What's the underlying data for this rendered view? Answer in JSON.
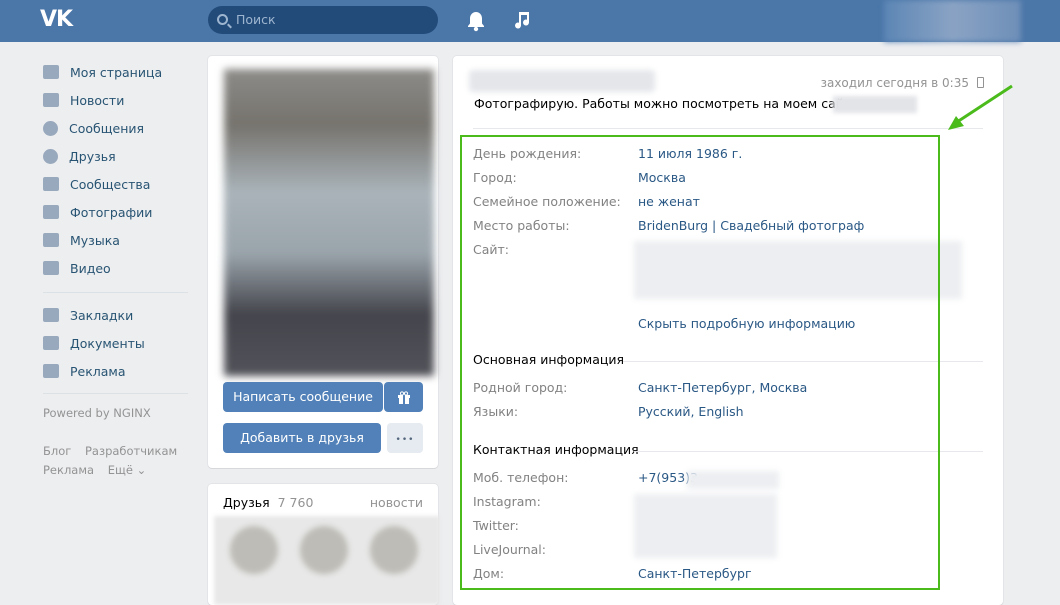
{
  "header": {
    "search_placeholder": "Поиск",
    "icons": [
      "vk-logo",
      "search-icon",
      "bell-icon",
      "music-icon"
    ]
  },
  "sidebar": {
    "items": [
      {
        "label": "Моя страница",
        "icon": "home-icon"
      },
      {
        "label": "Новости",
        "icon": "news-icon"
      },
      {
        "label": "Сообщения",
        "icon": "message-icon"
      },
      {
        "label": "Друзья",
        "icon": "person-icon"
      },
      {
        "label": "Сообщества",
        "icon": "group-icon"
      },
      {
        "label": "Фотографии",
        "icon": "camera-icon"
      },
      {
        "label": "Музыка",
        "icon": "music-icon"
      },
      {
        "label": "Видео",
        "icon": "video-icon"
      }
    ],
    "extra_items": [
      {
        "label": "Закладки",
        "icon": "star-icon"
      },
      {
        "label": "Документы",
        "icon": "document-icon"
      },
      {
        "label": "Реклама",
        "icon": "megaphone-icon"
      }
    ],
    "powered": "Powered by NGINX",
    "footer_links": [
      "Блог",
      "Разработчикам",
      "Реклама",
      "Ещё ⌄"
    ]
  },
  "profile_card": {
    "write_message": "Написать сообщение",
    "add_friend": "Добавить в друзья",
    "more": "•••"
  },
  "friends": {
    "title": "Друзья",
    "count": "7 760",
    "news_link": "новости"
  },
  "info": {
    "online": "заходил сегодня в 0:35",
    "status": "Фотографирую. Работы можно посмотреть на моем сайте",
    "rows": [
      {
        "label": "День рождения:",
        "value": "11 июля 1986 г."
      },
      {
        "label": "Город:",
        "value": "Москва"
      },
      {
        "label": "Семейное положение:",
        "value": "не женат"
      },
      {
        "label": "Место работы:",
        "value": "BridenBurg | Свадебный фотограф"
      },
      {
        "label": "Сайт:",
        "value": ""
      }
    ],
    "hide_details": "Скрыть подробную информацию",
    "basic_title": "Основная информация",
    "basic_rows": [
      {
        "label": "Родной город:",
        "value": "Санкт-Петербург, Москва"
      },
      {
        "label": "Языки:",
        "value": "Русский, English"
      }
    ],
    "contact_title": "Контактная информация",
    "contact_rows": [
      {
        "label": "Моб. телефон:",
        "value": "+7(953)3"
      },
      {
        "label": "Instagram:",
        "value": ""
      },
      {
        "label": "Twitter:",
        "value": ""
      },
      {
        "label": "LiveJournal:",
        "value": ""
      },
      {
        "label": "Дом:",
        "value": "Санкт-Петербург"
      }
    ]
  },
  "colors": {
    "header": "#4a76a8",
    "link": "#2a5885",
    "button": "#5181b8",
    "highlight_frame": "#4bbb1c"
  }
}
